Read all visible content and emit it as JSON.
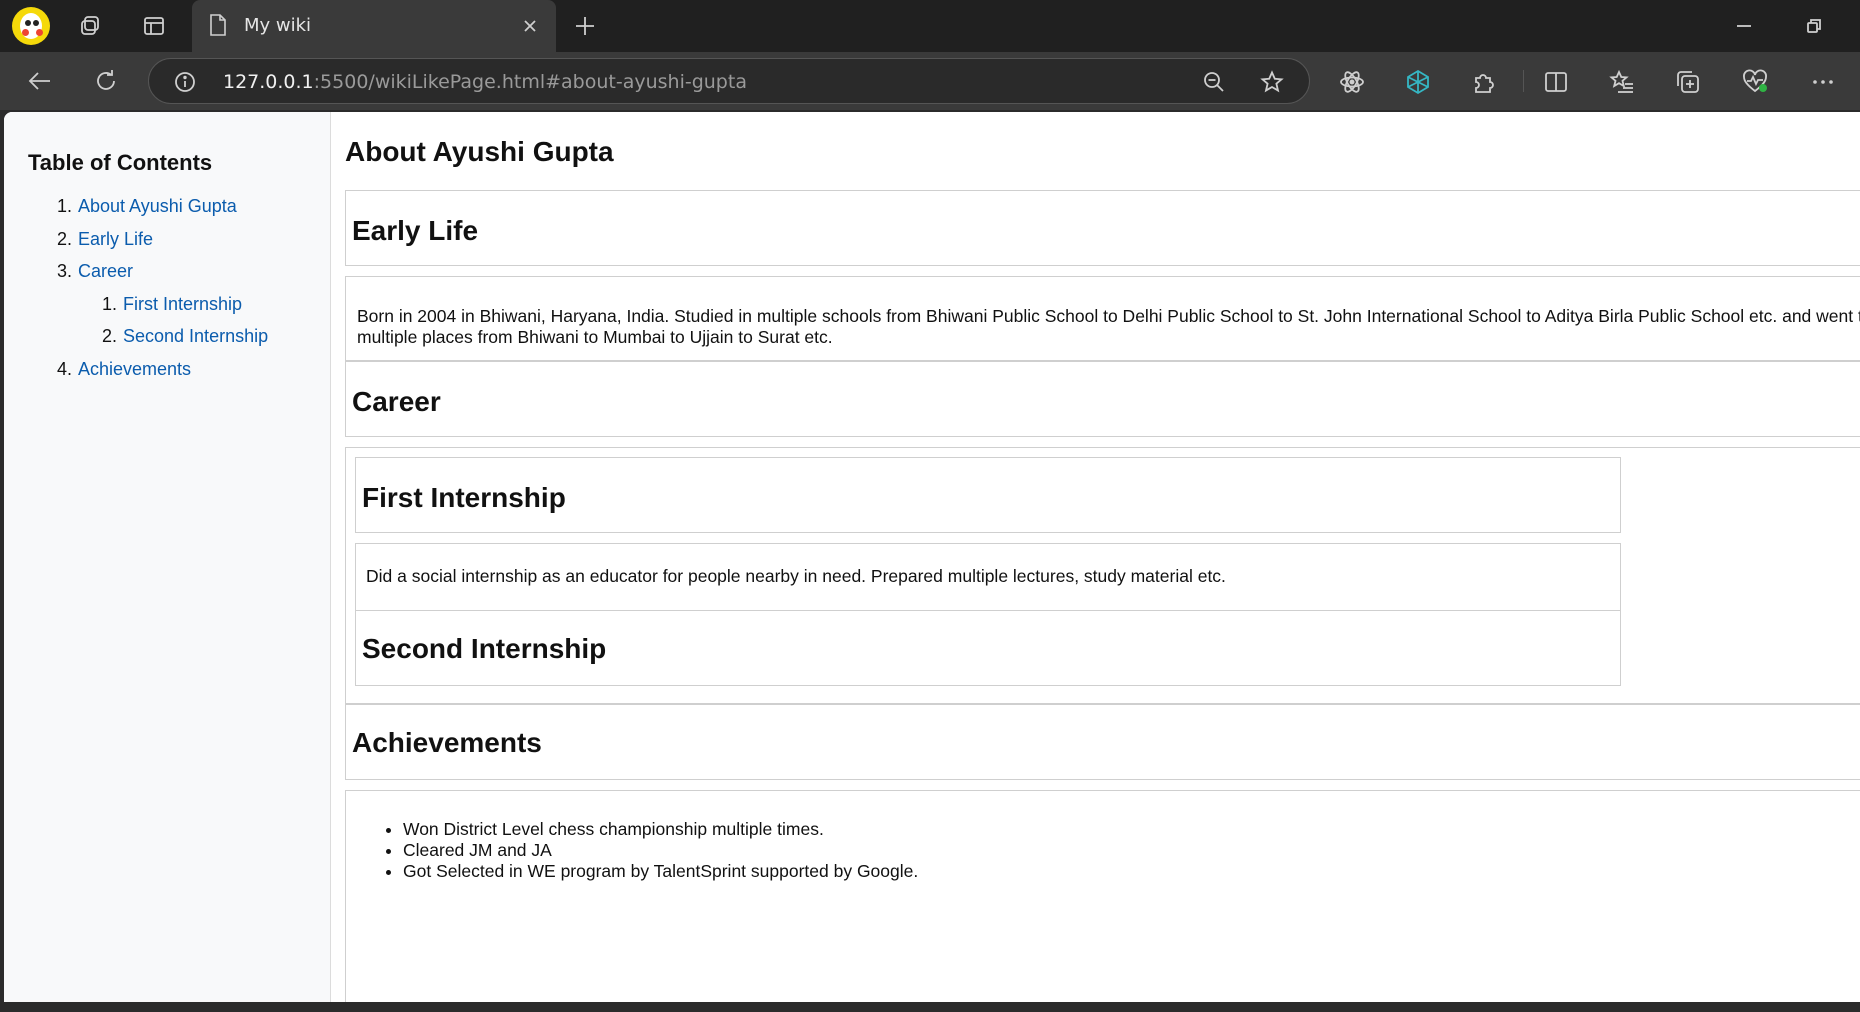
{
  "browser": {
    "tab": {
      "title": "My wiki"
    },
    "address": {
      "host": "127.0.0.1",
      "rest": ":5500/wikiLikePage.html#about-ayushi-gupta"
    }
  },
  "toc": {
    "heading": "Table of Contents",
    "items": [
      {
        "num": "1.",
        "label": "About Ayushi Gupta"
      },
      {
        "num": "2.",
        "label": "Early Life"
      },
      {
        "num": "3.",
        "label": "Career"
      },
      {
        "num": "1.",
        "label": "First Internship"
      },
      {
        "num": "2.",
        "label": "Second Internship"
      },
      {
        "num": "4.",
        "label": "Achievements"
      }
    ]
  },
  "article": {
    "title": "About Ayushi Gupta",
    "early_life": {
      "heading": "Early Life",
      "text": "Born in 2004 in Bhiwani, Haryana, India. Studied in multiple schools from Bhiwani Public School to Delhi Public School to St. John International School to Aditya Birla Public School etc. and went to multiple places from Bhiwani to Mumbai to Ujjain to Surat etc."
    },
    "career": {
      "heading": "Career",
      "first": {
        "heading": "First Internship",
        "text": "Did a social internship as an educator for people nearby in need. Prepared multiple lectures, study material etc."
      },
      "second": {
        "heading": "Second Internship"
      }
    },
    "achievements": {
      "heading": "Achievements",
      "items": [
        "Won District Level chess championship multiple times.",
        "Cleared JM and JA",
        "Got Selected in WE program by TalentSprint supported by Google."
      ]
    }
  }
}
